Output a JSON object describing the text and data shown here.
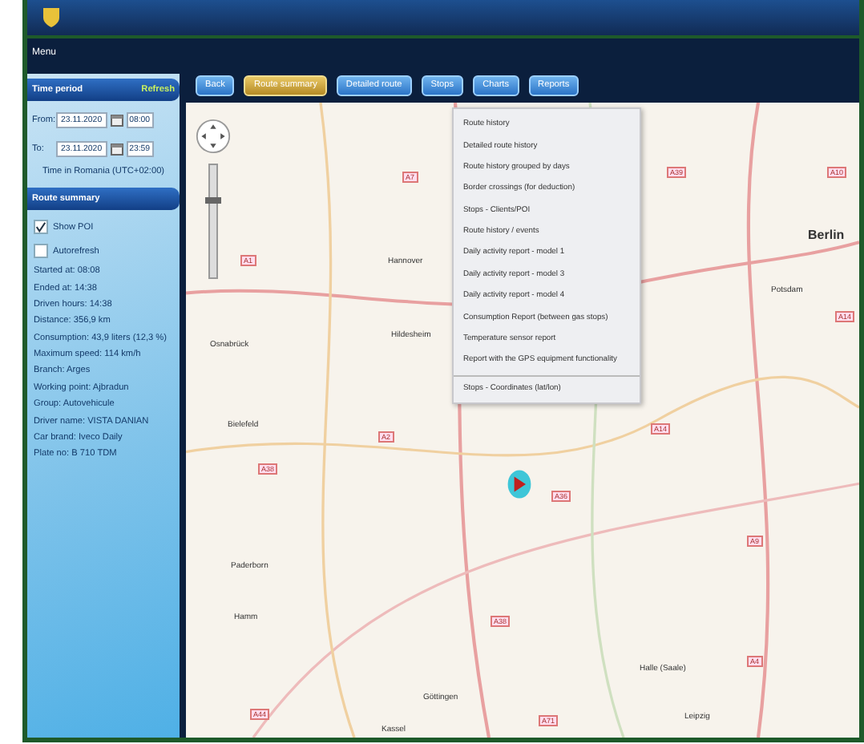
{
  "sidebar": {
    "title": "Menu",
    "time_period": {
      "title": "Time period",
      "refresh": "Refresh",
      "from_label": "From:",
      "from_date": "23.11.2020",
      "from_time": "08:00",
      "to_label": "To:",
      "to_date": "23.11.2020",
      "to_time": "23:59",
      "timezone": "Time in Romania (UTC+02:00)"
    },
    "route_summary": {
      "title": "Route summary",
      "options": [
        {
          "label": "Show POI",
          "checked": true
        },
        {
          "label": "Autorefresh",
          "checked": false
        }
      ],
      "lines": [
        "Started at: 08:08",
        "Ended at: 14:38",
        "Driven hours: 14:38",
        "Distance: 356,9 km",
        "Consumption: 43,9 liters (12,3 %)",
        "Maximum speed: 114 km/h",
        "Branch: Arges",
        "Working point: Ajbradun",
        "Group: Autovehicule",
        "Driver name: VISTA DANIAN",
        "Car brand: Iveco Daily",
        "Plate no: B 710 TDM"
      ]
    }
  },
  "tabs": [
    {
      "label": "Back",
      "selected": false
    },
    {
      "label": "Route summary",
      "selected": true
    },
    {
      "label": "Detailed route",
      "selected": false
    },
    {
      "label": "Stops",
      "selected": false
    },
    {
      "label": "Charts",
      "selected": false
    },
    {
      "label": "Reports",
      "selected": false
    }
  ],
  "reports_menu": [
    {
      "label": "Route history",
      "separated": false
    },
    {
      "label": "Detailed route history",
      "separated": false
    },
    {
      "label": "Route history grouped by days",
      "separated": false
    },
    {
      "label": "Border crossings (for deduction)",
      "separated": false
    },
    {
      "label": "Stops - Clients/POI",
      "separated": false
    },
    {
      "label": "Route history / events",
      "separated": false
    },
    {
      "label": "Daily activity report - model 1",
      "separated": false
    },
    {
      "label": "Daily activity report - model 3",
      "separated": false
    },
    {
      "label": "Daily activity report - model 4",
      "separated": false
    },
    {
      "label": "Consumption Report (between gas stops)",
      "separated": false
    },
    {
      "label": "Temperature sensor report",
      "separated": false
    },
    {
      "label": "Report with the GPS equipment functionality",
      "separated": false
    },
    {
      "label": "Stops - Coordinates (lat/lon)",
      "separated": true
    }
  ],
  "map": {
    "zoom": {
      "level": 0.7
    },
    "cities": [
      {
        "name": "Berlin",
        "kind": "major"
      },
      {
        "name": "Potsdam",
        "kind": "minor"
      },
      {
        "name": "Hannover",
        "kind": "minor"
      },
      {
        "name": "Hildesheim",
        "kind": "minor"
      },
      {
        "name": "Osnabrück",
        "kind": "minor"
      },
      {
        "name": "Bielefeld",
        "kind": "minor"
      },
      {
        "name": "Paderborn",
        "kind": "minor"
      },
      {
        "name": "Göttingen",
        "kind": "minor"
      },
      {
        "name": "Kassel",
        "kind": "minor"
      },
      {
        "name": "Halle (Saale)",
        "kind": "minor"
      },
      {
        "name": "Leipzig",
        "kind": "minor"
      },
      {
        "name": "Hamm",
        "kind": "minor"
      }
    ],
    "roads": [
      "A7",
      "A2",
      "A1",
      "A38",
      "A39",
      "A14",
      "A9",
      "A10",
      "A36",
      "A38",
      "A44",
      "A71",
      "A4",
      "A14"
    ]
  }
}
